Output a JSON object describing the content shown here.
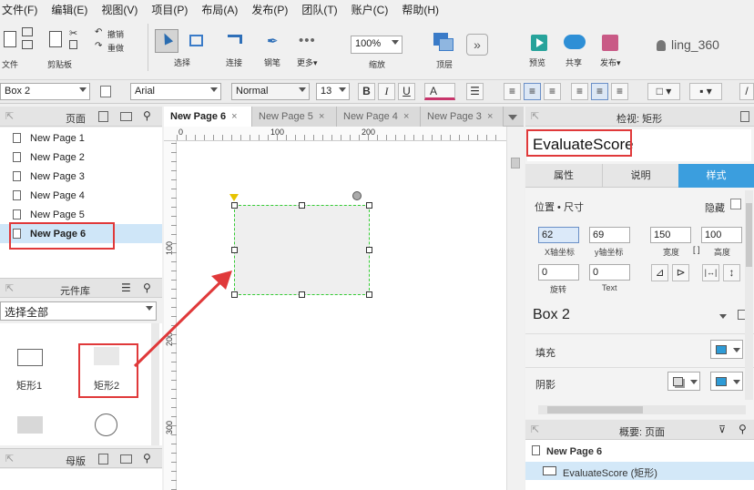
{
  "menu": [
    "文件(F)",
    "编辑(E)",
    "视图(V)",
    "项目(P)",
    "布局(A)",
    "发布(P)",
    "团队(T)",
    "账户(C)",
    "帮助(H)"
  ],
  "toolbar": {
    "file": "文件",
    "clipboard": "剪贴板",
    "undo": "撤销",
    "redo": "重做",
    "select": "选择",
    "connect": "连接",
    "pen": "钢笔",
    "more": "更多▾",
    "zoom_value": "100%",
    "zoom_label": "缩放",
    "top_label": "顶层",
    "preview": "预览",
    "share": "共享",
    "publish": "发布▾",
    "user": "ling_360"
  },
  "format": {
    "widget_name": "Box 2",
    "font": "Arial",
    "style": "Normal",
    "size": "13",
    "bold": "B",
    "italic": "I",
    "underline": "U",
    "font_color": "A"
  },
  "pages_panel": {
    "title": "页面",
    "pages": [
      "New Page 1",
      "New Page 2",
      "New Page 3",
      "New Page 4",
      "New Page 5",
      "New Page 6"
    ],
    "active": "New Page 6"
  },
  "library_panel": {
    "title": "元件库",
    "select_all": "选择全部",
    "items": [
      {
        "label": "矩形1"
      },
      {
        "label": "矩形2"
      }
    ]
  },
  "masters_panel": {
    "title": "母版"
  },
  "tabs": [
    {
      "label": "New Page 6",
      "close": "×",
      "active": true
    },
    {
      "label": "New Page 5",
      "close": "×"
    },
    {
      "label": "New Page 4",
      "close": "×"
    },
    {
      "label": "New Page 3",
      "close": "×"
    }
  ],
  "rulers": {
    "top": [
      "0",
      "100",
      "200"
    ],
    "left": [
      "100",
      "200",
      "300"
    ]
  },
  "inspector": {
    "title": "检视: 矩形",
    "shape_name": "EvaluateScore",
    "tabs": [
      "属性",
      "说明",
      "样式"
    ],
    "active_tab": "样式",
    "position_size": "位置 • 尺寸",
    "hidden": "隐藏",
    "x": "62",
    "x_label": "X轴坐标",
    "y": "69",
    "y_label": "y轴坐标",
    "w": "150",
    "w_label": "宽度",
    "h": "100",
    "h_label": "高度",
    "rotate": "0",
    "rotate_label": "旋转",
    "text_rotate": "0",
    "text_rotate_label": "Text",
    "style_name": "Box 2",
    "fill": "填充",
    "shadow": "阴影",
    "fill_color": "#2e9bd6"
  },
  "outline": {
    "title": "概要: 页面",
    "page": "New Page 6",
    "item": "EvaluateScore (矩形)"
  },
  "colors": {
    "accent": "#3b9ede",
    "annotation": "#e0393a",
    "selection": "#33cc33"
  }
}
